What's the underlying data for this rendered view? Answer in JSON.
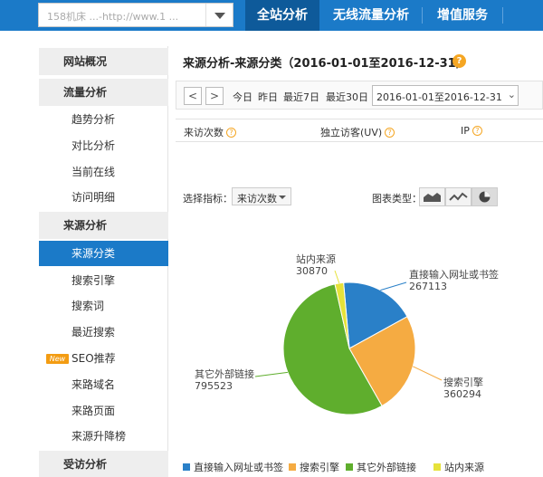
{
  "top": {
    "site_select_value": "158机床 ...-http://www.1 ...",
    "tabs": [
      "全站分析",
      "无线流量分析",
      "增值服务"
    ]
  },
  "sidebar": {
    "overview": "网站概况",
    "traffic_group": "流量分析",
    "traffic_items": [
      "趋势分析",
      "对比分析",
      "当前在线",
      "访问明细"
    ],
    "source_group": "来源分析",
    "source_items": [
      "来源分类",
      "搜索引擎",
      "搜索词",
      "最近搜索",
      "SEO推荐",
      "来路域名",
      "来路页面",
      "来源升降榜"
    ],
    "new_badge": "New",
    "visited_group": "受访分析"
  },
  "main": {
    "title": "来源分析-来源分类（2016-01-01至2016-12-31）",
    "help": "?",
    "nav_prev": "<",
    "nav_next": ">",
    "quick_ranges": [
      "今日",
      "昨日",
      "最近7日",
      "最近30日"
    ],
    "date_range_value": "2016-01-01至2016-12-31",
    "metrics": [
      "来访次数",
      "独立访客(UV)",
      "IP"
    ],
    "indicator_label": "选择指标：",
    "indicator_value": "来访次数",
    "chart_type_label": "图表类型："
  },
  "chart_data": {
    "type": "pie",
    "categories": [
      "直接输入网址或书签",
      "搜索引擎",
      "其它外部链接",
      "站内来源"
    ],
    "values": [
      267113,
      360294,
      795523,
      30870
    ],
    "colors": [
      "#2a80c8",
      "#f5ab42",
      "#5fae2d",
      "#e6e23a"
    ],
    "legend_position": "bottom"
  }
}
